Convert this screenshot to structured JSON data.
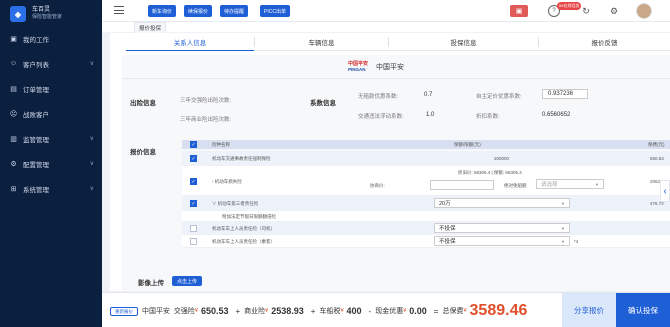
{
  "brand": {
    "name": "车百灵",
    "sub": "保险智能管家"
  },
  "sidebar": {
    "items": [
      {
        "label": "我的工作",
        "icon": "briefcase-icon",
        "chev": ""
      },
      {
        "label": "客户列表",
        "icon": "user-icon",
        "chev": "∨"
      },
      {
        "label": "订单管理",
        "icon": "order-icon",
        "chev": ""
      },
      {
        "label": "战败客户",
        "icon": "user-x-icon",
        "chev": ""
      },
      {
        "label": "监管管理",
        "icon": "monitor-icon",
        "chev": "∨"
      },
      {
        "label": "配置管理",
        "icon": "settings-icon",
        "chev": "∨"
      },
      {
        "label": "系统管理",
        "icon": "system-icon",
        "chev": "∨"
      }
    ]
  },
  "topbar": {
    "buttons": [
      "新车询价",
      "续保报价",
      "待办提醒",
      "PICC出单"
    ],
    "badge": "88在线话务",
    "icons": [
      "red-action-icon",
      "help-icon",
      "refresh-icon",
      "settings-icon"
    ]
  },
  "crumb": {
    "tab": "报价投保"
  },
  "tabs": [
    "关系人信息",
    "车辆信息",
    "投保信息",
    "报价反馈"
  ],
  "insurer": {
    "logo_cn": "中国平安",
    "logo_en": "PINGAN",
    "name": "中国平安"
  },
  "risk": {
    "label": "出险信息",
    "jq_label": "三年交强险出险次数:",
    "sy_label": "三年商业险出险次数:"
  },
  "coef": {
    "label": "系数信息",
    "wpf_label": "无赔款优惠系数:",
    "wpf_value": "0.7",
    "zz_label": "自主定价优惠系数:",
    "zz_value": "0.937236",
    "jt_label": "交通违法浮动系数:",
    "jt_value": "1.0",
    "zk_label": "折扣系数:",
    "zk_value": "0.6560652"
  },
  "quote": {
    "label": "报价信息",
    "headers": {
      "name": "险种名称",
      "amount": "保额/限额(元)",
      "premium": "保费(元)"
    },
    "rows": [
      {
        "name": "机动车交通事故责任强制保险",
        "amount": "200000",
        "premium": "650.53",
        "checked": true
      },
      {
        "name": "机动车损失险",
        "line1": "折旧价: 68306.4 | 保额: 68306.4",
        "premium": "2062.21",
        "checked": true,
        "extra_label": "协商价:",
        "extra2_label": "绝对免赔额",
        "select_placeholder": "请选择"
      },
      {
        "name": "机动车第三者责任险",
        "amount": "20万",
        "premium": "476.72",
        "checked": true
      },
      {
        "name": "附加法定节假日限额翻倍险",
        "checked": false
      },
      {
        "name": "机动车车上人员责任险（司机）",
        "amount": "不投保",
        "checked": false
      },
      {
        "name": "机动车车上人员责任险（乘客）",
        "amount": "不投保",
        "checked": false,
        "suffix": "*4"
      }
    ]
  },
  "image_upload": {
    "label": "影像上传",
    "button": "点击上传"
  },
  "footer": {
    "reset": "重新报价",
    "insurer": "中国平安",
    "jq_label": "交强险",
    "jq_value": "650.53",
    "sy_label": "商业险",
    "sy_value": "2538.93",
    "cc_label": "车船税",
    "cc_value": "400",
    "xj_label": "现金优惠",
    "xj_value": "0.00",
    "total_label": "总保费",
    "total_value": "3589.46",
    "share": "分享报价",
    "confirm": "确认投保"
  }
}
